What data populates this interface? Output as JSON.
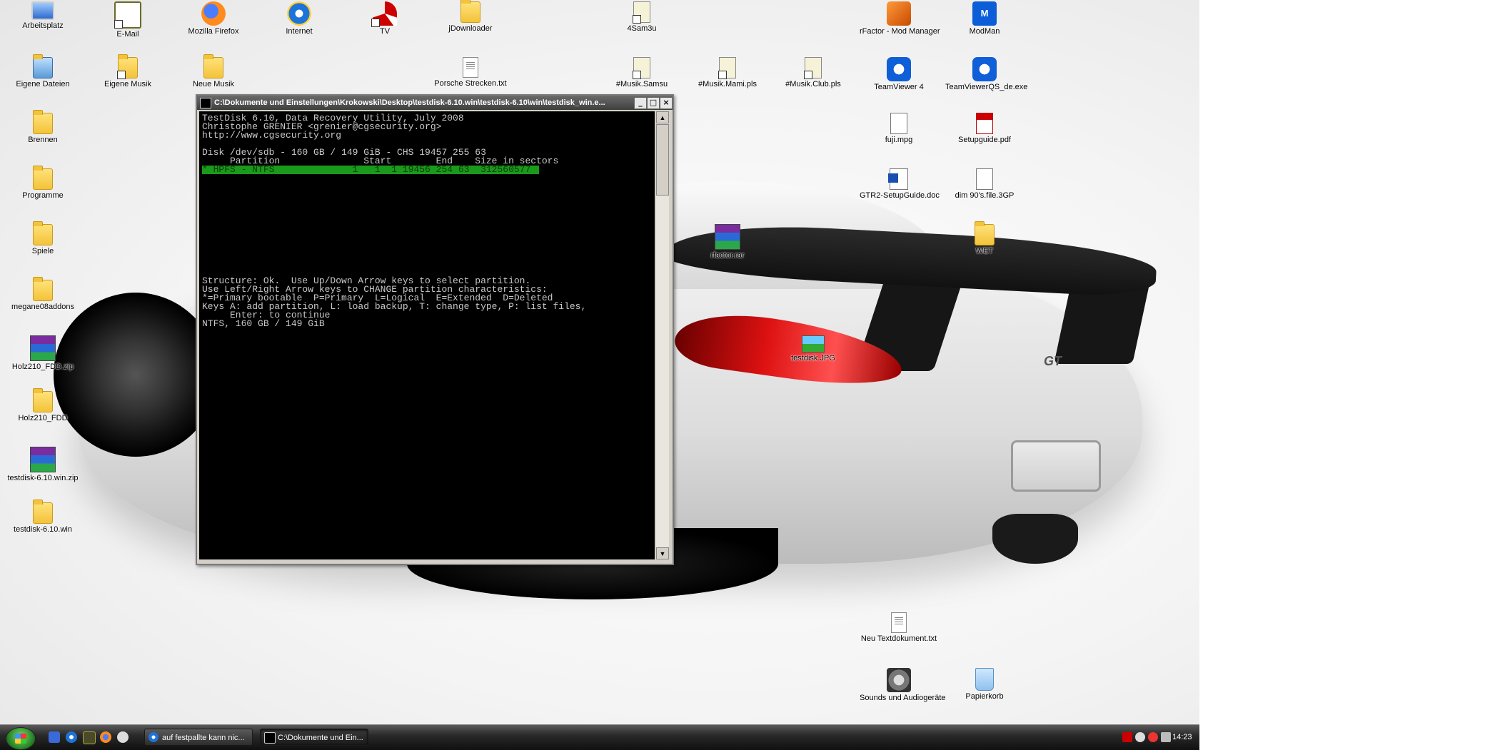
{
  "desktop": {
    "icons": [
      {
        "id": "arbeitsplatz",
        "label": "Arbeitsplatz",
        "icon": "computer-icon"
      },
      {
        "id": "email",
        "label": "E-Mail",
        "icon": "mail-icon"
      },
      {
        "id": "firefox",
        "label": "Mozilla Firefox",
        "icon": "firefox-icon"
      },
      {
        "id": "internet",
        "label": "Internet",
        "icon": "internet-explorer-icon"
      },
      {
        "id": "tv",
        "label": "TV",
        "icon": "tv-icon"
      },
      {
        "id": "jdownloader",
        "label": "jDownloader",
        "icon": "folder-icon"
      },
      {
        "id": "4sam3u",
        "label": "4Sam3u",
        "icon": "playlist-icon"
      },
      {
        "id": "rfactor-mm",
        "label": "rFactor - Mod Manager",
        "icon": "mod-manager-icon"
      },
      {
        "id": "modman",
        "label": "ModMan",
        "icon": "modman-icon"
      },
      {
        "id": "eigene-dateien",
        "label": "Eigene Dateien",
        "icon": "my-documents-icon"
      },
      {
        "id": "eigene-musik",
        "label": "Eigene Musik",
        "icon": "my-music-icon"
      },
      {
        "id": "neue-musik",
        "label": "Neue Musik",
        "icon": "folder-icon"
      },
      {
        "id": "porsche-strecken",
        "label": "Porsche Strecken.txt",
        "icon": "text-file-icon"
      },
      {
        "id": "musik-samsu",
        "label": "#Musik.Samsu",
        "icon": "playlist-icon"
      },
      {
        "id": "musik-mami",
        "label": "#Musik.Mami.pls",
        "icon": "playlist-icon"
      },
      {
        "id": "musik-club",
        "label": "#Musik.Club.pls",
        "icon": "playlist-icon"
      },
      {
        "id": "teamviewer4",
        "label": "TeamViewer 4",
        "icon": "teamviewer-icon"
      },
      {
        "id": "teamviewerqs",
        "label": "TeamViewerQS_de.exe",
        "icon": "teamviewer-icon"
      },
      {
        "id": "brennen",
        "label": "Brennen",
        "icon": "folder-icon"
      },
      {
        "id": "fuji",
        "label": "fuji.mpg",
        "icon": "video-file-icon"
      },
      {
        "id": "setupguide",
        "label": "Setupguide.pdf",
        "icon": "pdf-file-icon"
      },
      {
        "id": "programme",
        "label": "Programme",
        "icon": "folder-icon"
      },
      {
        "id": "gtr2",
        "label": "GTR2-SetupGuide.doc",
        "icon": "word-file-icon"
      },
      {
        "id": "dim3gp",
        "label": "dim 90's.file.3GP",
        "icon": "media-file-icon"
      },
      {
        "id": "spiele",
        "label": "Spiele",
        "icon": "folder-icon"
      },
      {
        "id": "rfactor-rar",
        "label": "rfactor.rar",
        "icon": "rar-archive-icon"
      },
      {
        "id": "wet",
        "label": "WET",
        "icon": "folder-icon"
      },
      {
        "id": "megane",
        "label": "megane08addons",
        "icon": "folder-icon"
      },
      {
        "id": "holz-zip",
        "label": "Holz210_FDD.zip",
        "icon": "rar-archive-icon"
      },
      {
        "id": "testdisk-jpg",
        "label": "testdisk.JPG",
        "icon": "image-file-icon"
      },
      {
        "id": "holz-folder",
        "label": "Holz210_FDD",
        "icon": "folder-icon"
      },
      {
        "id": "testdisk-zip",
        "label": "testdisk-6.10.win.zip",
        "icon": "rar-archive-icon"
      },
      {
        "id": "testdisk-folder",
        "label": "testdisk-6.10.win",
        "icon": "folder-icon"
      },
      {
        "id": "neu-textdok",
        "label": "Neu Textdokument.txt",
        "icon": "text-file-icon"
      },
      {
        "id": "sounds",
        "label": "Sounds und Audiogeräte",
        "icon": "speaker-icon"
      },
      {
        "id": "papierkorb",
        "label": "Papierkorb",
        "icon": "recycle-bin-icon"
      }
    ],
    "wallpaper_badge": "GT"
  },
  "cmd_window": {
    "title": "C:\\Dokumente und Einstellungen\\Krokowski\\Desktop\\testdisk-6.10.win\\testdisk-6.10\\win\\testdisk_win.e...",
    "buttons": {
      "minimize": "_",
      "maximize": "□",
      "close": "×"
    },
    "lines": [
      "TestDisk 6.10, Data Recovery Utility, July 2008",
      "Christophe GRENIER <grenier@cgsecurity.org>",
      "http://www.cgsecurity.org",
      "",
      "Disk /dev/sdb - 160 GB / 149 GiB - CHS 19457 255 63",
      "     Partition               Start        End    Size in sectors",
      "* HPFS - NTFS              1   1  1 19456 254 63  312560577",
      "Structure: Ok.  Use Up/Down Arrow keys to select partition.",
      "Use Left/Right Arrow keys to CHANGE partition characteristics:",
      "*=Primary bootable  P=Primary  L=Logical  E=Extended  D=Deleted",
      "Keys A: add partition, L: load backup, T: change type, P: list files,",
      "     Enter: to continue",
      "NTFS, 160 GB / 149 GiB"
    ]
  },
  "taskbar": {
    "tasks": [
      {
        "label": "auf festpallte kann nic...",
        "icon": "internet-explorer-icon"
      },
      {
        "label": "C:\\Dokumente und Ein...",
        "icon": "console-icon"
      }
    ],
    "clock": "14:23"
  },
  "colors": {
    "console_bg": "#000000",
    "console_text": "#c8c8c8",
    "highlight": "#1a9a1a",
    "taskbar": "#1a1a1a"
  }
}
